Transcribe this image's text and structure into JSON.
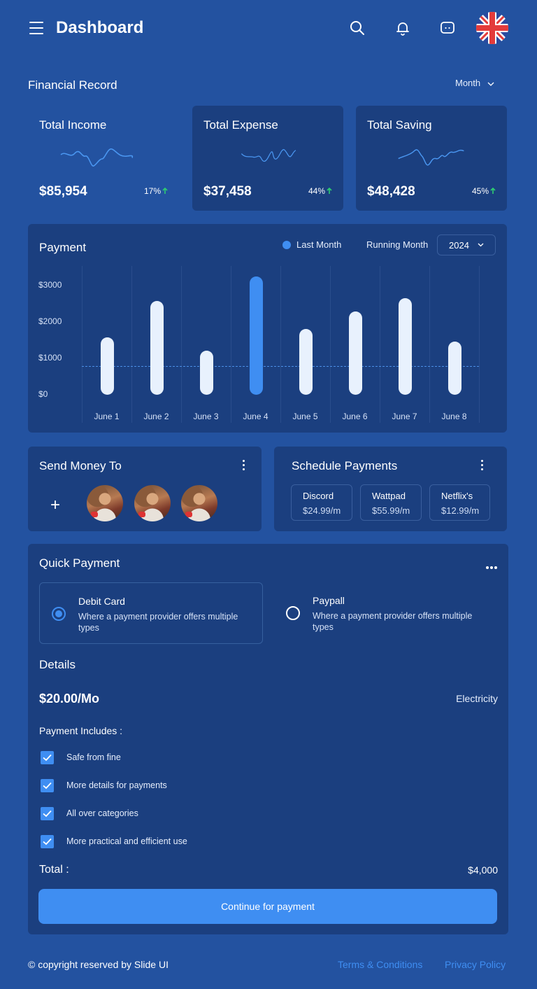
{
  "header": {
    "title": "Dashboard"
  },
  "financial": {
    "title": "Financial Record",
    "period": "Month",
    "cards": [
      {
        "label": "Total Income",
        "value": "$85,954",
        "pct": "17%"
      },
      {
        "label": "Total Expense",
        "value": "$37,458",
        "pct": "44%"
      },
      {
        "label": "Total Saving",
        "value": "$48,428",
        "pct": "45%"
      }
    ]
  },
  "payment": {
    "title": "Payment",
    "legend_last": "Last Month",
    "legend_running": "Running Month",
    "year": "2024"
  },
  "chart_data": {
    "type": "bar",
    "categories": [
      "June 1",
      "June 2",
      "June 3",
      "June 4",
      "June 5",
      "June 6",
      "June 7",
      "June 8"
    ],
    "values": [
      1580,
      2580,
      1210,
      3250,
      1800,
      2280,
      2640,
      1450
    ],
    "highlight_index": 3,
    "reference_line": 1100,
    "ylim": [
      0,
      3300
    ],
    "yticks": [
      "$3000",
      "$2000",
      "$1000",
      "$0"
    ],
    "grid": true
  },
  "send_money": {
    "title": "Send Money To",
    "add": "+"
  },
  "schedule": {
    "title": "Schedule Payments",
    "items": [
      {
        "name": "Discord",
        "price": "$24.99/m"
      },
      {
        "name": "Wattpad",
        "price": "$55.99/m"
      },
      {
        "name": "Netflix's",
        "price": "$12.99/m"
      }
    ]
  },
  "quick_payment": {
    "title": "Quick Payment",
    "options": [
      {
        "title": "Debit Card",
        "desc": "Where a payment provider offers multiple types",
        "selected": true
      },
      {
        "title": "Paypall",
        "desc": "Where a payment provider offers multiple types",
        "selected": false
      }
    ],
    "details_title": "Details",
    "amount": "$20.00/Mo",
    "category": "Electricity",
    "includes_title": "Payment Includes :",
    "includes": [
      "Safe from fine",
      "More details for payments",
      "All over categories",
      "More practical and efficient use"
    ],
    "total_label": "Total :",
    "total_value": "$4,000",
    "cta": "Continue for payment"
  },
  "footer": {
    "copyright": "© copyright reserved by Slide UI",
    "terms": "Terms & Conditions",
    "privacy": "Privacy Policy"
  },
  "colors": {
    "background": "#2352a0",
    "card": "#1b3f7f",
    "accent": "#3f8ef2",
    "up": "#2ecc71"
  }
}
